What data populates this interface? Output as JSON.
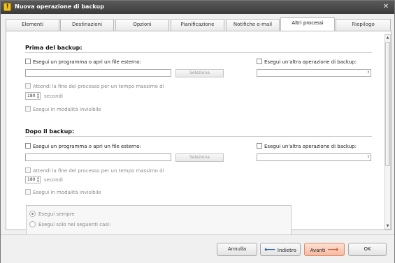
{
  "window": {
    "title": "Nuova operazione di backup",
    "close_icon": "close-icon"
  },
  "tabs": [
    {
      "label": "Elementi",
      "active": false
    },
    {
      "label": "Destinazioni",
      "active": false
    },
    {
      "label": "Opzioni",
      "active": false
    },
    {
      "label": "Pianificazione",
      "active": false
    },
    {
      "label": "Notifiche e-mail",
      "active": false
    },
    {
      "label": "Altri processi",
      "active": true
    },
    {
      "label": "Riepilogo",
      "active": false
    }
  ],
  "before": {
    "title": "Prima del backup:",
    "run_program_label": "Esegui un programma o apri un file esterno:",
    "program_value": "",
    "select_button": "Seleziona",
    "other_backup_label": "Esegui un'altra operazione di backup:",
    "other_backup_value": "",
    "wait_label": "Attendi la fine del processo per un tempo massimo di",
    "wait_value": "180",
    "seconds_label": "secondi",
    "invisible_label": "Esegui in modalità invisibile"
  },
  "after": {
    "title": "Dopo il backup:",
    "run_program_label": "Esegui un programma o apri un file esterno:",
    "program_value": "",
    "select_button": "Seleziona",
    "other_backup_label": "Esegui un'altra operazione di backup:",
    "other_backup_value": "",
    "wait_label": "Attendi la fine del processo per un tempo massimo di",
    "wait_value": "180",
    "seconds_label": "secondi",
    "invisible_label": "Esegui in modalità invisibile",
    "radio_always": "Esegui sempre",
    "radio_cases": "Esegui solo nei seguenti casi:"
  },
  "footer": {
    "cancel": "Annulla",
    "back": "Indietro",
    "next": "Avanti",
    "ok": "OK"
  }
}
